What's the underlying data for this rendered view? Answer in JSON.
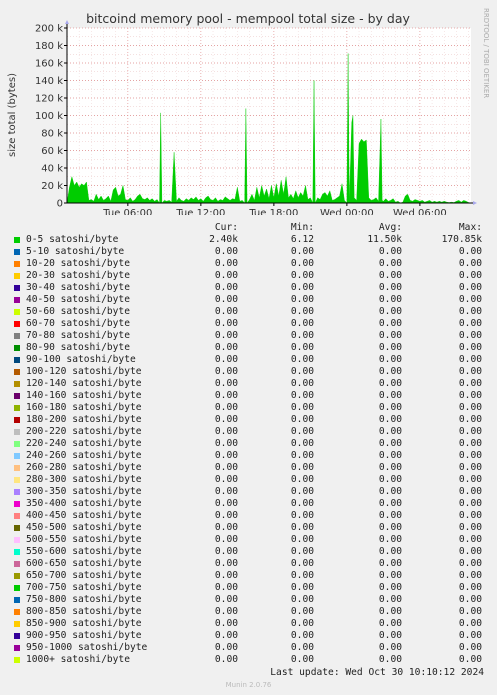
{
  "chart_data": {
    "type": "area",
    "title": "bitcoind memory pool - mempool total size - by day",
    "ylabel": "size total (bytes)",
    "xlabel": "",
    "ylim": [
      0,
      200000
    ],
    "yticks": [
      0,
      20000,
      40000,
      60000,
      80000,
      100000,
      120000,
      140000,
      160000,
      180000,
      200000
    ],
    "ytick_labels": [
      "0",
      "20 k",
      "40 k",
      "60 k",
      "80 k",
      "100 k",
      "120 k",
      "140 k",
      "160 k",
      "180 k",
      "200 k"
    ],
    "x_start_hour": 1,
    "x_end_hour": 34.2,
    "xticks": [
      {
        "hour": 6,
        "label": "Tue 06:00"
      },
      {
        "hour": 12,
        "label": "Tue 12:00"
      },
      {
        "hour": 18,
        "label": "Tue 18:00"
      },
      {
        "hour": 24,
        "label": "Wed 00:00"
      },
      {
        "hour": 30,
        "label": "Wed 06:00"
      }
    ],
    "grid": true,
    "series": [
      {
        "name": "0-5 satoshi/byte",
        "color": "#00cc00",
        "points": [
          [
            1.0,
            0
          ],
          [
            1.2,
            18000
          ],
          [
            1.4,
            30000
          ],
          [
            1.6,
            20000
          ],
          [
            1.8,
            24000
          ],
          [
            2.0,
            18000
          ],
          [
            2.2,
            22000
          ],
          [
            2.4,
            20000
          ],
          [
            2.6,
            24000
          ],
          [
            2.8,
            3000
          ],
          [
            3.0,
            4000
          ],
          [
            3.2,
            2000
          ],
          [
            3.4,
            10000
          ],
          [
            3.6,
            4000
          ],
          [
            3.8,
            8000
          ],
          [
            4.0,
            3000
          ],
          [
            4.2,
            5000
          ],
          [
            4.4,
            8000
          ],
          [
            4.6,
            2000
          ],
          [
            4.8,
            15000
          ],
          [
            5.0,
            18000
          ],
          [
            5.2,
            8000
          ],
          [
            5.4,
            10000
          ],
          [
            5.6,
            20000
          ],
          [
            5.8,
            4000
          ],
          [
            6.0,
            3000
          ],
          [
            6.2,
            6000
          ],
          [
            6.4,
            2000
          ],
          [
            6.6,
            4000
          ],
          [
            6.8,
            8000
          ],
          [
            7.0,
            10000
          ],
          [
            7.2,
            5000
          ],
          [
            7.4,
            4000
          ],
          [
            7.6,
            6000
          ],
          [
            7.8,
            3000
          ],
          [
            8.0,
            5000
          ],
          [
            8.2,
            2000
          ],
          [
            8.4,
            4000
          ],
          [
            8.6,
            0
          ],
          [
            8.7,
            103000
          ],
          [
            8.8,
            0
          ],
          [
            9.0,
            3000
          ],
          [
            9.2,
            2000
          ],
          [
            9.4,
            3000
          ],
          [
            9.6,
            1000
          ],
          [
            9.8,
            58000
          ],
          [
            10.0,
            2000
          ],
          [
            10.2,
            6000
          ],
          [
            10.4,
            3000
          ],
          [
            10.6,
            2000
          ],
          [
            10.8,
            5000
          ],
          [
            11.0,
            3000
          ],
          [
            11.2,
            6000
          ],
          [
            11.4,
            4000
          ],
          [
            11.6,
            7000
          ],
          [
            11.8,
            3000
          ],
          [
            12.0,
            5000
          ],
          [
            12.2,
            2000
          ],
          [
            12.4,
            6000
          ],
          [
            12.6,
            8000
          ],
          [
            12.8,
            4000
          ],
          [
            13.0,
            3000
          ],
          [
            13.2,
            6000
          ],
          [
            13.4,
            2000
          ],
          [
            13.6,
            4000
          ],
          [
            13.8,
            3000
          ],
          [
            14.0,
            7000
          ],
          [
            14.2,
            5000
          ],
          [
            14.4,
            3000
          ],
          [
            14.6,
            5000
          ],
          [
            14.8,
            4000
          ],
          [
            15.0,
            18000
          ],
          [
            15.2,
            2000
          ],
          [
            15.4,
            3000
          ],
          [
            15.6,
            0
          ],
          [
            15.7,
            108000
          ],
          [
            15.8,
            0
          ],
          [
            16.0,
            4000
          ],
          [
            16.2,
            10000
          ],
          [
            16.4,
            3000
          ],
          [
            16.6,
            18000
          ],
          [
            16.8,
            6000
          ],
          [
            17.0,
            20000
          ],
          [
            17.2,
            8000
          ],
          [
            17.4,
            16000
          ],
          [
            17.6,
            5000
          ],
          [
            17.8,
            20000
          ],
          [
            18.0,
            6000
          ],
          [
            18.2,
            22000
          ],
          [
            18.4,
            8000
          ],
          [
            18.6,
            26000
          ],
          [
            18.8,
            10000
          ],
          [
            19.0,
            30000
          ],
          [
            19.2,
            6000
          ],
          [
            19.4,
            10000
          ],
          [
            19.6,
            5000
          ],
          [
            19.8,
            14000
          ],
          [
            20.0,
            6000
          ],
          [
            20.2,
            12000
          ],
          [
            20.4,
            8000
          ],
          [
            20.6,
            20000
          ],
          [
            20.8,
            4000
          ],
          [
            21.0,
            6000
          ],
          [
            21.2,
            0
          ],
          [
            21.3,
            140000
          ],
          [
            21.4,
            0
          ],
          [
            21.6,
            6000
          ],
          [
            21.8,
            4000
          ],
          [
            22.0,
            10000
          ],
          [
            22.2,
            12000
          ],
          [
            22.4,
            8000
          ],
          [
            22.6,
            14000
          ],
          [
            22.8,
            3000
          ],
          [
            23.0,
            4000
          ],
          [
            23.2,
            6000
          ],
          [
            23.4,
            8000
          ],
          [
            23.6,
            22000
          ],
          [
            23.8,
            3000
          ],
          [
            24.0,
            0
          ],
          [
            24.1,
            170850
          ],
          [
            24.2,
            0
          ],
          [
            24.4,
            92000
          ],
          [
            24.5,
            100000
          ],
          [
            24.6,
            6000
          ],
          [
            24.8,
            3000
          ],
          [
            25.0,
            68000
          ],
          [
            25.2,
            73000
          ],
          [
            25.4,
            70000
          ],
          [
            25.6,
            72000
          ],
          [
            25.8,
            6000
          ],
          [
            26.0,
            3000
          ],
          [
            26.2,
            4000
          ],
          [
            26.4,
            6000
          ],
          [
            26.6,
            2000
          ],
          [
            26.8,
            96000
          ],
          [
            26.9,
            3000
          ],
          [
            27.0,
            2000
          ],
          [
            27.2,
            5000
          ],
          [
            27.4,
            2000
          ],
          [
            27.6,
            3000
          ],
          [
            27.8,
            5000
          ],
          [
            28.0,
            1000
          ],
          [
            28.2,
            2000
          ],
          [
            28.4,
            0
          ],
          [
            28.6,
            1000
          ],
          [
            28.8,
            8000
          ],
          [
            29.0,
            10000
          ],
          [
            29.2,
            3000
          ],
          [
            29.4,
            2000
          ],
          [
            29.6,
            4000
          ],
          [
            29.8,
            3000
          ],
          [
            30.0,
            2000
          ],
          [
            30.2,
            3000
          ],
          [
            30.4,
            1000
          ],
          [
            30.6,
            2000
          ],
          [
            30.8,
            3000
          ],
          [
            31.0,
            1000
          ],
          [
            31.2,
            2000
          ],
          [
            31.4,
            1000
          ],
          [
            31.6,
            2000
          ],
          [
            31.8,
            1000
          ],
          [
            32.0,
            2000
          ],
          [
            32.2,
            1000
          ],
          [
            32.4,
            500
          ],
          [
            32.6,
            1000
          ],
          [
            32.8,
            500
          ],
          [
            33.0,
            2000
          ],
          [
            33.2,
            3000
          ],
          [
            33.4,
            1000
          ],
          [
            33.6,
            3000
          ],
          [
            33.8,
            2000
          ],
          [
            34.0,
            500
          ],
          [
            34.2,
            0
          ]
        ]
      }
    ]
  },
  "side_label": "RRDTOOL / TOBI OETIKER",
  "legend": {
    "headers": [
      "Cur:",
      "Min:",
      "Avg:",
      "Max:"
    ],
    "rows": [
      {
        "name": "0-5 satoshi/byte",
        "color": "#00cc00",
        "cur": "2.40k",
        "min": "6.12",
        "avg": "11.50k",
        "max": "170.85k"
      },
      {
        "name": "5-10 satoshi/byte",
        "color": "#0066b3",
        "cur": "0.00",
        "min": "0.00",
        "avg": "0.00",
        "max": "0.00"
      },
      {
        "name": "10-20 satoshi/byte",
        "color": "#ff8000",
        "cur": "0.00",
        "min": "0.00",
        "avg": "0.00",
        "max": "0.00"
      },
      {
        "name": "20-30 satoshi/byte",
        "color": "#ffcc00",
        "cur": "0.00",
        "min": "0.00",
        "avg": "0.00",
        "max": "0.00"
      },
      {
        "name": "30-40 satoshi/byte",
        "color": "#330099",
        "cur": "0.00",
        "min": "0.00",
        "avg": "0.00",
        "max": "0.00"
      },
      {
        "name": "40-50 satoshi/byte",
        "color": "#990099",
        "cur": "0.00",
        "min": "0.00",
        "avg": "0.00",
        "max": "0.00"
      },
      {
        "name": "50-60 satoshi/byte",
        "color": "#ccff00",
        "cur": "0.00",
        "min": "0.00",
        "avg": "0.00",
        "max": "0.00"
      },
      {
        "name": "60-70 satoshi/byte",
        "color": "#ff0000",
        "cur": "0.00",
        "min": "0.00",
        "avg": "0.00",
        "max": "0.00"
      },
      {
        "name": "70-80 satoshi/byte",
        "color": "#808080",
        "cur": "0.00",
        "min": "0.00",
        "avg": "0.00",
        "max": "0.00"
      },
      {
        "name": "80-90 satoshi/byte",
        "color": "#008f00",
        "cur": "0.00",
        "min": "0.00",
        "avg": "0.00",
        "max": "0.00"
      },
      {
        "name": "90-100 satoshi/byte",
        "color": "#00487d",
        "cur": "0.00",
        "min": "0.00",
        "avg": "0.00",
        "max": "0.00"
      },
      {
        "name": "100-120 satoshi/byte",
        "color": "#b35a00",
        "cur": "0.00",
        "min": "0.00",
        "avg": "0.00",
        "max": "0.00"
      },
      {
        "name": "120-140 satoshi/byte",
        "color": "#b38f00",
        "cur": "0.00",
        "min": "0.00",
        "avg": "0.00",
        "max": "0.00"
      },
      {
        "name": "140-160 satoshi/byte",
        "color": "#6b006b",
        "cur": "0.00",
        "min": "0.00",
        "avg": "0.00",
        "max": "0.00"
      },
      {
        "name": "160-180 satoshi/byte",
        "color": "#8fb300",
        "cur": "0.00",
        "min": "0.00",
        "avg": "0.00",
        "max": "0.00"
      },
      {
        "name": "180-200 satoshi/byte",
        "color": "#b30000",
        "cur": "0.00",
        "min": "0.00",
        "avg": "0.00",
        "max": "0.00"
      },
      {
        "name": "200-220 satoshi/byte",
        "color": "#bebebe",
        "cur": "0.00",
        "min": "0.00",
        "avg": "0.00",
        "max": "0.00"
      },
      {
        "name": "220-240 satoshi/byte",
        "color": "#80ff80",
        "cur": "0.00",
        "min": "0.00",
        "avg": "0.00",
        "max": "0.00"
      },
      {
        "name": "240-260 satoshi/byte",
        "color": "#80c9ff",
        "cur": "0.00",
        "min": "0.00",
        "avg": "0.00",
        "max": "0.00"
      },
      {
        "name": "260-280 satoshi/byte",
        "color": "#ffc080",
        "cur": "0.00",
        "min": "0.00",
        "avg": "0.00",
        "max": "0.00"
      },
      {
        "name": "280-300 satoshi/byte",
        "color": "#ffe680",
        "cur": "0.00",
        "min": "0.00",
        "avg": "0.00",
        "max": "0.00"
      },
      {
        "name": "300-350 satoshi/byte",
        "color": "#aa80ff",
        "cur": "0.00",
        "min": "0.00",
        "avg": "0.00",
        "max": "0.00"
      },
      {
        "name": "350-400 satoshi/byte",
        "color": "#ee00cc",
        "cur": "0.00",
        "min": "0.00",
        "avg": "0.00",
        "max": "0.00"
      },
      {
        "name": "400-450 satoshi/byte",
        "color": "#ff8080",
        "cur": "0.00",
        "min": "0.00",
        "avg": "0.00",
        "max": "0.00"
      },
      {
        "name": "450-500 satoshi/byte",
        "color": "#666600",
        "cur": "0.00",
        "min": "0.00",
        "avg": "0.00",
        "max": "0.00"
      },
      {
        "name": "500-550 satoshi/byte",
        "color": "#ffbfff",
        "cur": "0.00",
        "min": "0.00",
        "avg": "0.00",
        "max": "0.00"
      },
      {
        "name": "550-600 satoshi/byte",
        "color": "#00ffcc",
        "cur": "0.00",
        "min": "0.00",
        "avg": "0.00",
        "max": "0.00"
      },
      {
        "name": "600-650 satoshi/byte",
        "color": "#cc6699",
        "cur": "0.00",
        "min": "0.00",
        "avg": "0.00",
        "max": "0.00"
      },
      {
        "name": "650-700 satoshi/byte",
        "color": "#999900",
        "cur": "0.00",
        "min": "0.00",
        "avg": "0.00",
        "max": "0.00"
      },
      {
        "name": "700-750 satoshi/byte",
        "color": "#00cc00",
        "cur": "0.00",
        "min": "0.00",
        "avg": "0.00",
        "max": "0.00"
      },
      {
        "name": "750-800 satoshi/byte",
        "color": "#0066b3",
        "cur": "0.00",
        "min": "0.00",
        "avg": "0.00",
        "max": "0.00"
      },
      {
        "name": "800-850 satoshi/byte",
        "color": "#ff8000",
        "cur": "0.00",
        "min": "0.00",
        "avg": "0.00",
        "max": "0.00"
      },
      {
        "name": "850-900 satoshi/byte",
        "color": "#ffcc00",
        "cur": "0.00",
        "min": "0.00",
        "avg": "0.00",
        "max": "0.00"
      },
      {
        "name": "900-950 satoshi/byte",
        "color": "#330099",
        "cur": "0.00",
        "min": "0.00",
        "avg": "0.00",
        "max": "0.00"
      },
      {
        "name": "950-1000 satoshi/byte",
        "color": "#990099",
        "cur": "0.00",
        "min": "0.00",
        "avg": "0.00",
        "max": "0.00"
      },
      {
        "name": "1000+ satoshi/byte",
        "color": "#ccff00",
        "cur": "0.00",
        "min": "0.00",
        "avg": "0.00",
        "max": "0.00"
      }
    ]
  },
  "last_update": "Last update: Wed Oct 30 10:10:12 2024",
  "footer": "Munin 2.0.76"
}
